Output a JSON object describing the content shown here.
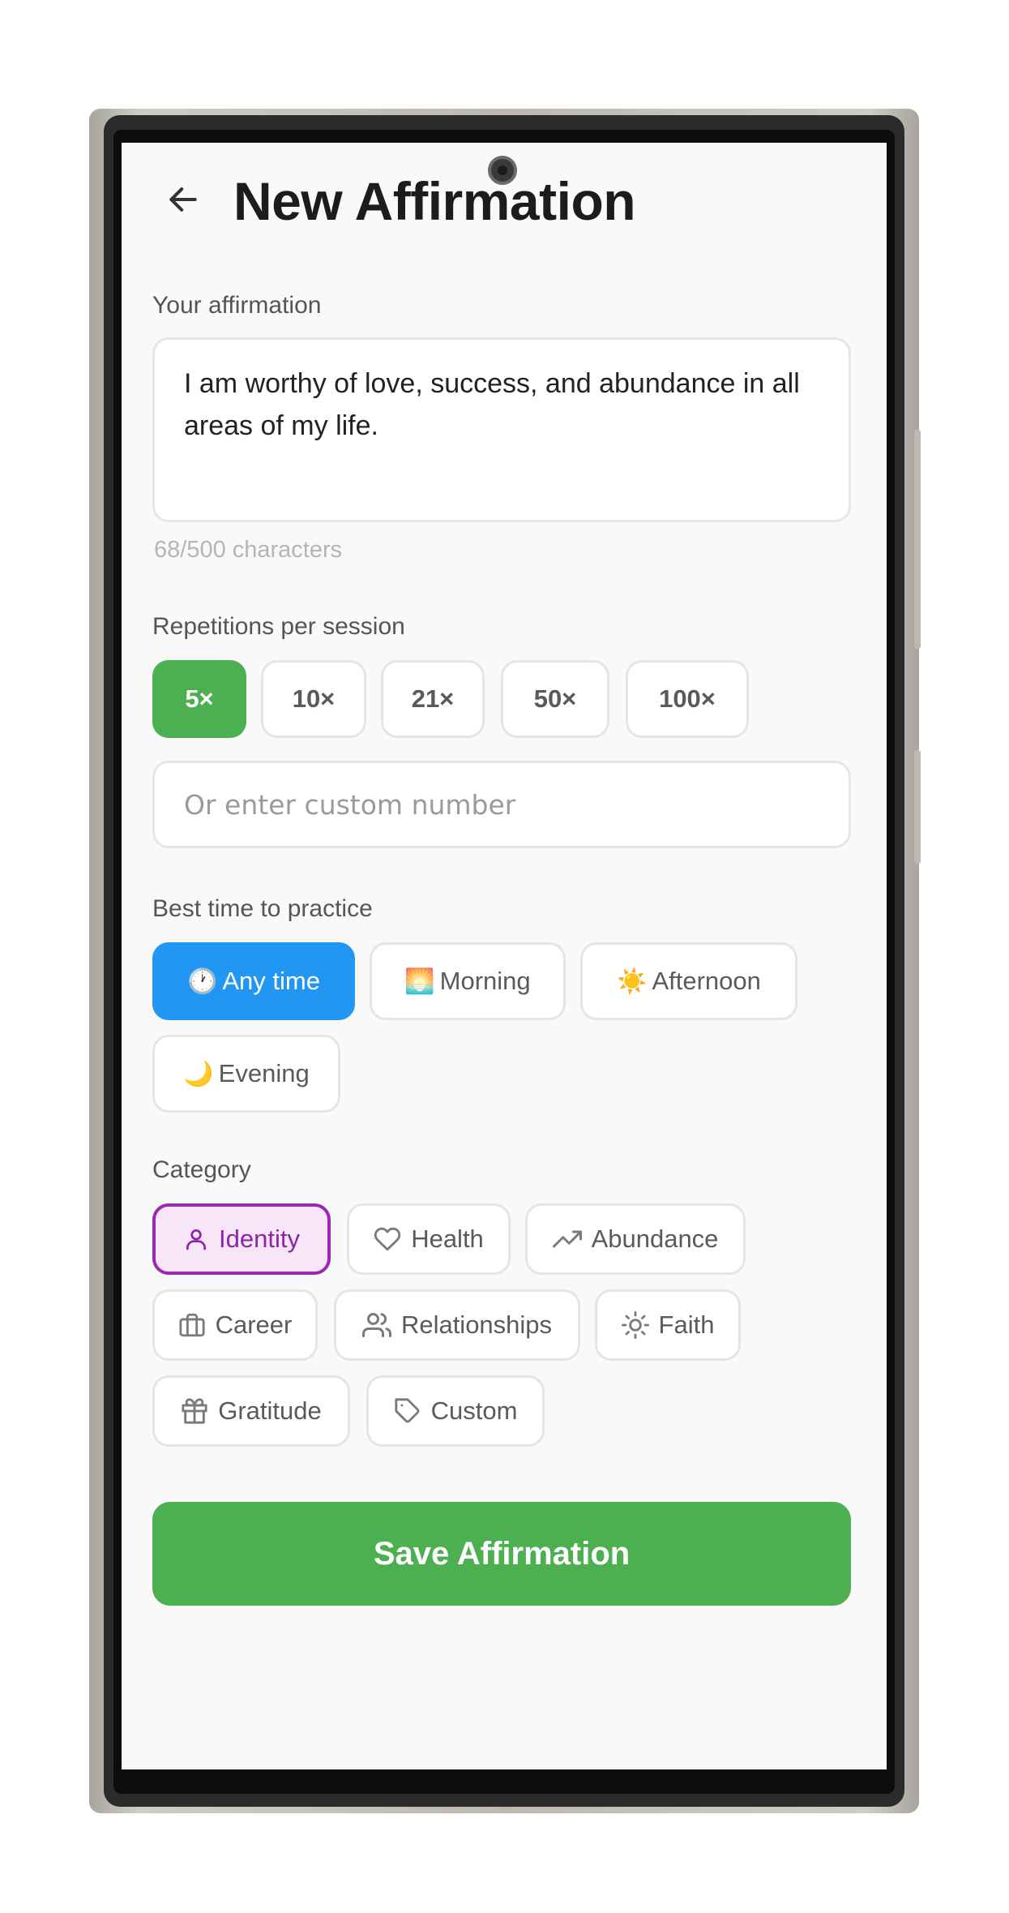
{
  "header": {
    "title": "New Affirmation",
    "back_icon": "arrow-left-icon"
  },
  "affirmation": {
    "label": "Your affirmation",
    "text": "I am worthy of love, success, and abundance in all areas of my life.",
    "char_count": "68/500 characters"
  },
  "repetitions": {
    "label": "Repetitions per session",
    "options": [
      "5×",
      "10×",
      "21×",
      "50×",
      "100×"
    ],
    "selected": "5×",
    "custom_placeholder": "Or enter custom number"
  },
  "time": {
    "label": "Best time to practice",
    "options": [
      {
        "emoji": "🕐",
        "label": "Any time"
      },
      {
        "emoji": "🌅",
        "label": "Morning"
      },
      {
        "emoji": "☀️",
        "label": "Afternoon"
      },
      {
        "emoji": "🌙",
        "label": "Evening"
      }
    ],
    "selected": "Any time"
  },
  "category": {
    "label": "Category",
    "options": [
      {
        "icon": "user-icon",
        "label": "Identity"
      },
      {
        "icon": "heart-icon",
        "label": "Health"
      },
      {
        "icon": "trending-up-icon",
        "label": "Abundance"
      },
      {
        "icon": "briefcase-icon",
        "label": "Career"
      },
      {
        "icon": "users-icon",
        "label": "Relationships"
      },
      {
        "icon": "sun-icon",
        "label": "Faith"
      },
      {
        "icon": "gift-icon",
        "label": "Gratitude"
      },
      {
        "icon": "tag-icon",
        "label": "Custom"
      }
    ],
    "selected": "Identity"
  },
  "save_button": {
    "label": "Save Affirmation"
  },
  "colors": {
    "green": "#4caf50",
    "blue": "#2196f3",
    "purple": "#9c27b0",
    "purple_bg": "#f6e6f8"
  }
}
